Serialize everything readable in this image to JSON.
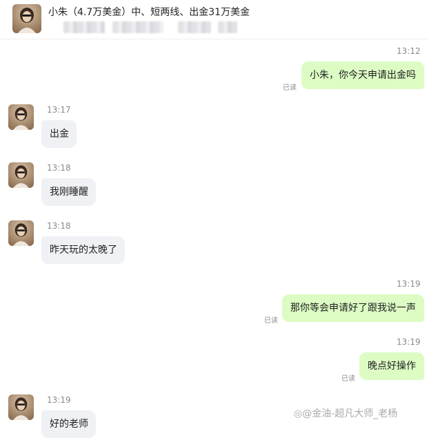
{
  "header": {
    "title": "小朱（4.7万美金）中、短两线、出金31万美金"
  },
  "messages": [
    {
      "side": "right",
      "time": "13:12",
      "text": "小朱，你今天申请出金吗",
      "read": "已读"
    },
    {
      "side": "left",
      "time": "13:17",
      "text": "出金"
    },
    {
      "side": "left",
      "time": "13:18",
      "text": "我刚睡醒"
    },
    {
      "side": "left",
      "time": "13:18",
      "text": "昨天玩的太晚了"
    },
    {
      "side": "right",
      "time": "13:19",
      "text": "那你等会申请好了跟我说一声",
      "read": "已读"
    },
    {
      "side": "right",
      "time": "13:19",
      "text": "晚点好操作",
      "read": "已读"
    },
    {
      "side": "left",
      "time": "13:19",
      "text": "好的老师"
    }
  ],
  "watermark": "@金油-超凡大师_老杨",
  "colors": {
    "outgoing_bubble": "#dcfcc4",
    "incoming_bubble": "#f0f1f5",
    "timestamp": "#8a8a8a"
  }
}
